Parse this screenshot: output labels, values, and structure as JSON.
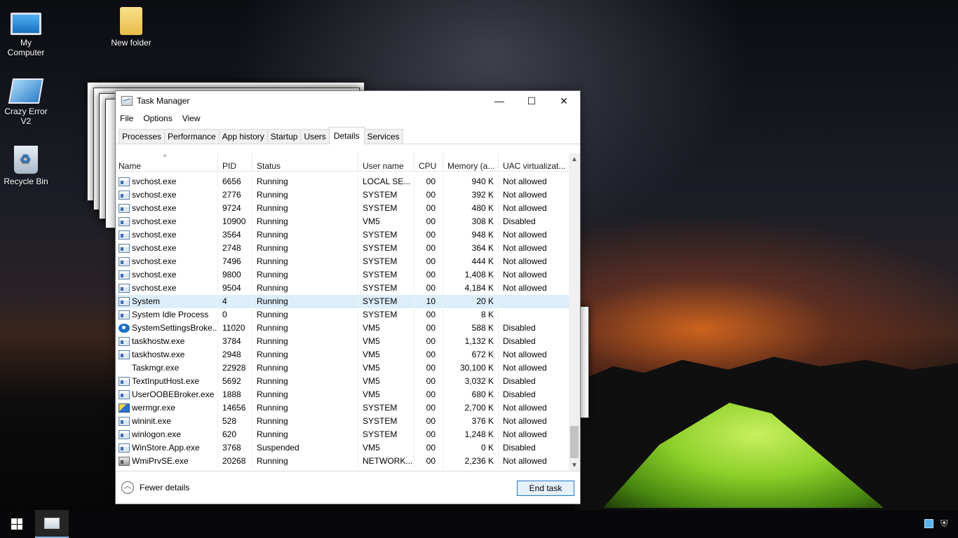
{
  "desktop": {
    "icons": [
      {
        "label": "My Computer",
        "icon": "computer-icon"
      },
      {
        "label": "New folder",
        "icon": "folder-icon"
      },
      {
        "label": "Crazy Error V2",
        "icon": "app-shortcut-icon"
      },
      {
        "label": "Recycle Bin",
        "icon": "recycle-bin-icon"
      }
    ]
  },
  "window": {
    "title": "Task Manager",
    "controls": {
      "minimize": "—",
      "maximize": "☐",
      "close": "✕"
    },
    "menu": [
      "File",
      "Options",
      "View"
    ],
    "tabs": [
      "Processes",
      "Performance",
      "App history",
      "Startup",
      "Users",
      "Details",
      "Services"
    ],
    "active_tab": "Details",
    "columns": [
      "Name",
      "PID",
      "Status",
      "User name",
      "CPU",
      "Memory (a...",
      "UAC virtualizat..."
    ],
    "rows": [
      {
        "name": "svchost.exe",
        "pid": "6656",
        "status": "Running",
        "user": "LOCAL SE...",
        "cpu": "00",
        "mem": "940 K",
        "uac": "Not allowed",
        "icon": "svc"
      },
      {
        "name": "svchost.exe",
        "pid": "2776",
        "status": "Running",
        "user": "SYSTEM",
        "cpu": "00",
        "mem": "392 K",
        "uac": "Not allowed",
        "icon": "svc"
      },
      {
        "name": "svchost.exe",
        "pid": "9724",
        "status": "Running",
        "user": "SYSTEM",
        "cpu": "00",
        "mem": "480 K",
        "uac": "Not allowed",
        "icon": "svc"
      },
      {
        "name": "svchost.exe",
        "pid": "10900",
        "status": "Running",
        "user": "VM5",
        "cpu": "00",
        "mem": "308 K",
        "uac": "Disabled",
        "icon": "svc"
      },
      {
        "name": "svchost.exe",
        "pid": "3564",
        "status": "Running",
        "user": "SYSTEM",
        "cpu": "00",
        "mem": "948 K",
        "uac": "Not allowed",
        "icon": "svc"
      },
      {
        "name": "svchost.exe",
        "pid": "2748",
        "status": "Running",
        "user": "SYSTEM",
        "cpu": "00",
        "mem": "364 K",
        "uac": "Not allowed",
        "icon": "svc"
      },
      {
        "name": "svchost.exe",
        "pid": "7496",
        "status": "Running",
        "user": "SYSTEM",
        "cpu": "00",
        "mem": "444 K",
        "uac": "Not allowed",
        "icon": "svc"
      },
      {
        "name": "svchost.exe",
        "pid": "9800",
        "status": "Running",
        "user": "SYSTEM",
        "cpu": "00",
        "mem": "1,408 K",
        "uac": "Not allowed",
        "icon": "svc"
      },
      {
        "name": "svchost.exe",
        "pid": "9504",
        "status": "Running",
        "user": "SYSTEM",
        "cpu": "00",
        "mem": "4,184 K",
        "uac": "Not allowed",
        "icon": "svc"
      },
      {
        "name": "System",
        "pid": "4",
        "status": "Running",
        "user": "SYSTEM",
        "cpu": "10",
        "mem": "20 K",
        "uac": "",
        "icon": "svc",
        "selected": true
      },
      {
        "name": "System Idle Process",
        "pid": "0",
        "status": "Running",
        "user": "SYSTEM",
        "cpu": "00",
        "mem": "8 K",
        "uac": "",
        "icon": "svc"
      },
      {
        "name": "SystemSettingsBroke...",
        "pid": "11020",
        "status": "Running",
        "user": "VM5",
        "cpu": "00",
        "mem": "588 K",
        "uac": "Disabled",
        "icon": "gear"
      },
      {
        "name": "taskhostw.exe",
        "pid": "3784",
        "status": "Running",
        "user": "VM5",
        "cpu": "00",
        "mem": "1,132 K",
        "uac": "Disabled",
        "icon": "svc"
      },
      {
        "name": "taskhostw.exe",
        "pid": "2948",
        "status": "Running",
        "user": "VM5",
        "cpu": "00",
        "mem": "672 K",
        "uac": "Not allowed",
        "icon": "svc"
      },
      {
        "name": "Taskmgr.exe",
        "pid": "22928",
        "status": "Running",
        "user": "VM5",
        "cpu": "00",
        "mem": "30,100 K",
        "uac": "Not allowed",
        "icon": "tm"
      },
      {
        "name": "TextInputHost.exe",
        "pid": "5692",
        "status": "Running",
        "user": "VM5",
        "cpu": "00",
        "mem": "3,032 K",
        "uac": "Disabled",
        "icon": "svc"
      },
      {
        "name": "UserOOBEBroker.exe",
        "pid": "1888",
        "status": "Running",
        "user": "VM5",
        "cpu": "00",
        "mem": "680 K",
        "uac": "Disabled",
        "icon": "svc"
      },
      {
        "name": "wermgr.exe",
        "pid": "14656",
        "status": "Running",
        "user": "SYSTEM",
        "cpu": "00",
        "mem": "2,700 K",
        "uac": "Not allowed",
        "icon": "shield"
      },
      {
        "name": "wininit.exe",
        "pid": "528",
        "status": "Running",
        "user": "SYSTEM",
        "cpu": "00",
        "mem": "376 K",
        "uac": "Not allowed",
        "icon": "svc"
      },
      {
        "name": "winlogon.exe",
        "pid": "620",
        "status": "Running",
        "user": "SYSTEM",
        "cpu": "00",
        "mem": "1,248 K",
        "uac": "Not allowed",
        "icon": "svc"
      },
      {
        "name": "WinStore.App.exe",
        "pid": "3768",
        "status": "Suspended",
        "user": "VM5",
        "cpu": "00",
        "mem": "0 K",
        "uac": "Disabled",
        "icon": "svc"
      },
      {
        "name": "WmiPrvSE.exe",
        "pid": "20268",
        "status": "Running",
        "user": "NETWORK...",
        "cpu": "00",
        "mem": "2,236 K",
        "uac": "Not allowed",
        "icon": "wmi"
      }
    ],
    "footer": {
      "fewer_details": "Fewer details",
      "end_task": "End task"
    }
  },
  "taskbar": {
    "active_app": "Task Manager"
  }
}
